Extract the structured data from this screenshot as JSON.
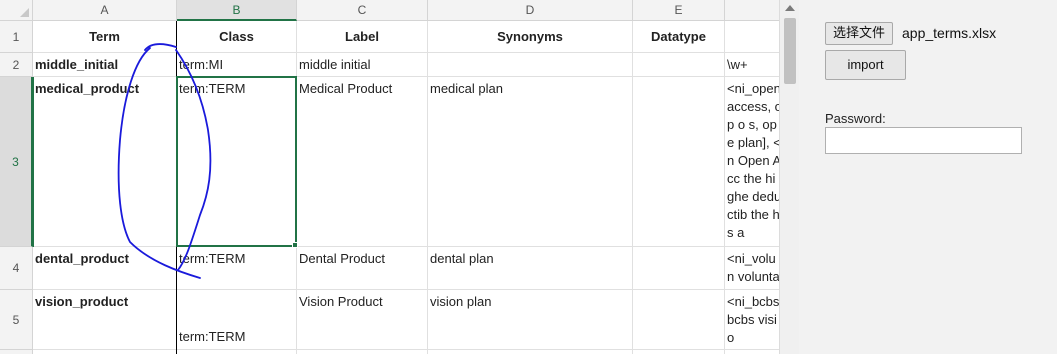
{
  "spreadsheet": {
    "column_letters": [
      "A",
      "B",
      "C",
      "D",
      "E"
    ],
    "row_numbers": [
      "1",
      "2",
      "3",
      "4",
      "5"
    ],
    "headers": [
      "Term",
      "Class",
      "Label",
      "Synonyms",
      "Datatype"
    ],
    "rows": [
      {
        "term": "middle_initial",
        "class": "term:MI",
        "label": "middle initial",
        "synonyms": "",
        "datatype": "",
        "extra": "\\w+"
      },
      {
        "term": "medical_product",
        "class": "term:TERM",
        "label": "Medical Product",
        "synonyms": "medical plan",
        "datatype": "",
        "extra": "<ni_open access, o p o s, ope plan], <n Open Acc the highe deductib the h s a"
      },
      {
        "term": "dental_product",
        "class": "term:TERM",
        "label": "Dental Product",
        "synonyms": "dental plan",
        "datatype": "",
        "extra": "<ni_volun voluntary"
      },
      {
        "term": "vision_product",
        "class": "term:TERM",
        "label": "Vision Product",
        "synonyms": "vision plan",
        "datatype": "",
        "extra": "<ni_bcbs bcbs visio"
      }
    ],
    "selected_cell": "B3",
    "annotation_color": "#1a1adb"
  },
  "panel": {
    "choose_file_label": "选择文件",
    "file_name": "app_terms.xlsx",
    "import_label": "import",
    "password_label": "Password:",
    "password_value": ""
  }
}
